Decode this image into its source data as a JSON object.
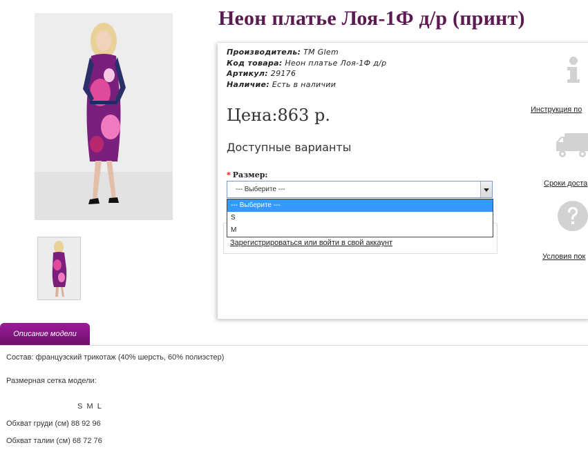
{
  "product": {
    "title": "Неон платье Лоя-1Ф д/р (принт)",
    "manufacturer_label": "Производитель:",
    "manufacturer": "ТМ Glem",
    "code_label": "Код товара:",
    "code": "Неон платье Лоя-1Ф д/р",
    "sku_label": "Артикул:",
    "sku": "29176",
    "availability_label": "Наличие:",
    "availability": "Есть в наличии",
    "price": "Цена:863 р.",
    "variants_heading": "Доступные варианты"
  },
  "size_select": {
    "label": "Размер:",
    "value": "--- Выберите ---",
    "options": [
      "--- Выберите ---",
      "S",
      "M"
    ]
  },
  "account": {
    "login_link": "Зарегистрироваться или войти в свой аккаунт"
  },
  "side_links": {
    "instruction": "Инструкция по",
    "delivery": "Сроки доста",
    "conditions": "Условия пок"
  },
  "tabs": {
    "description": "Описание модели"
  },
  "description": {
    "composition": "Состав: французский трикотаж (40% шерсть, 60% полиэстер)",
    "size_grid_title": "Размерная сетка модели:",
    "size_header": "S  M  L",
    "bust": "Обхват груди (см) 88 92 96",
    "waist": "Обхват талии (см) 68 72 76"
  },
  "colors": {
    "title": "#5b1a52",
    "tab": "#8a1786",
    "selected_option": "#3399ff"
  }
}
